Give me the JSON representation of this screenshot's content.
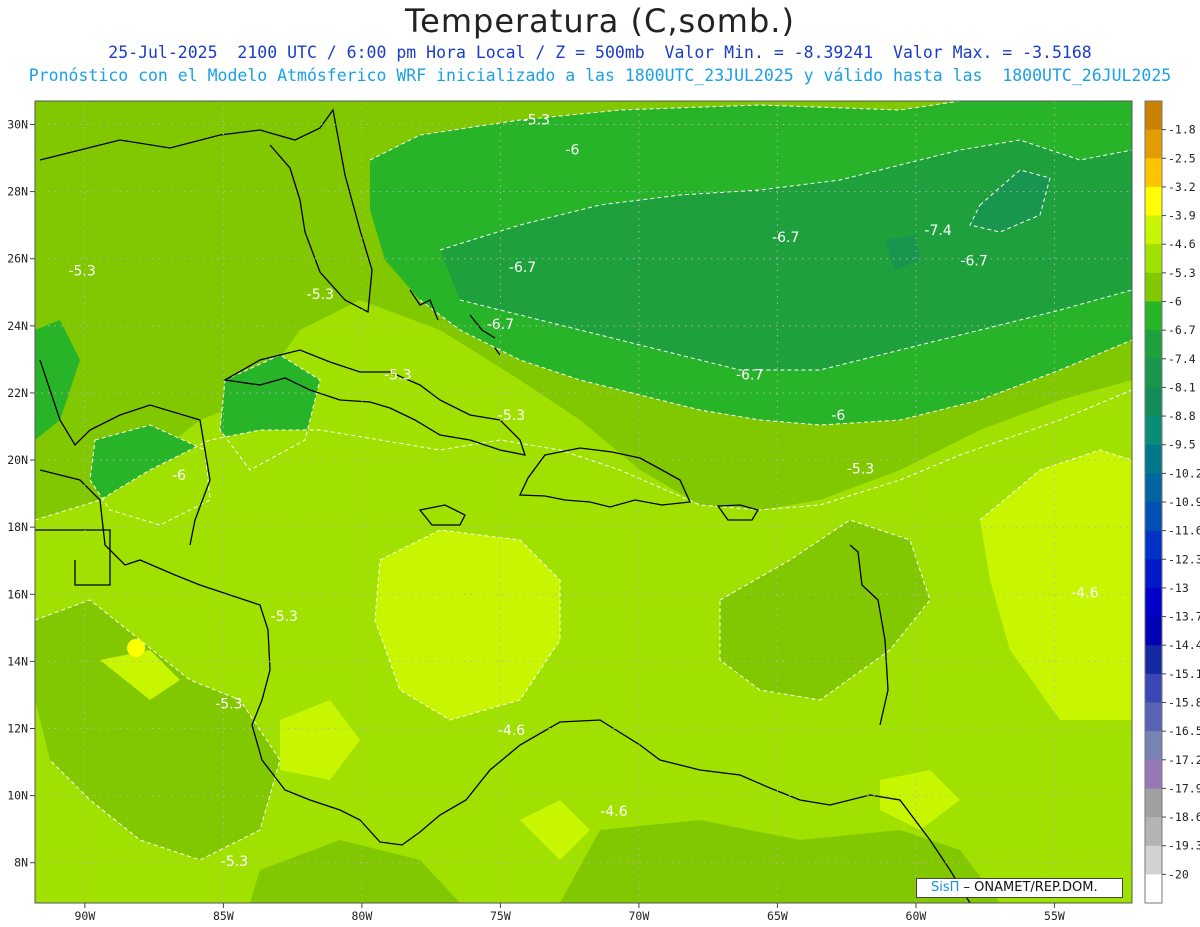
{
  "header": {
    "title": "Temperatura (C,somb.)",
    "line1": "25-Jul-2025  2100 UTC / 6:00 pm Hora Local / Z = 500mb  Valor Min. = -8.39241  Valor Max. = -3.5168",
    "line2": "Pronóstico con el Modelo Atmósferico WRF inicializado a las 1800UTC_23JUL2025 y válido hasta las  1800UTC_26JUL2025"
  },
  "axes": {
    "lat_labels": [
      "30N",
      "28N",
      "26N",
      "24N",
      "22N",
      "20N",
      "18N",
      "16N",
      "14N",
      "12N",
      "10N",
      "8N"
    ],
    "lon_labels": [
      "90W",
      "85W",
      "80W",
      "75W",
      "70W",
      "65W",
      "60W",
      "55W"
    ],
    "lat_range": [
      6.8,
      30.7
    ],
    "lon_range": [
      -91.8,
      -52.2
    ]
  },
  "colorbar": {
    "levels": [
      "-1.8",
      "-2.5",
      "-3.2",
      "-3.9",
      "-4.6",
      "-5.3",
      "-6",
      "-6.7",
      "-7.4",
      "-8.1",
      "-8.8",
      "-9.5",
      "-10.2",
      "-10.9",
      "-11.6",
      "-12.3",
      "-13",
      "-13.7",
      "-14.4",
      "-15.1",
      "-15.8",
      "-16.5",
      "-17.2",
      "-17.9",
      "-18.6",
      "-19.3",
      "-20"
    ],
    "colors": [
      "#c88200",
      "#e49c00",
      "#ffc400",
      "#ffff00",
      "#c8f500",
      "#a0e100",
      "#82c800",
      "#28b428",
      "#1ea03c",
      "#189650",
      "#148c5a",
      "#0a8c78",
      "#00788c",
      "#0064a0",
      "#0050b4",
      "#0032c8",
      "#0019c8",
      "#0000c8",
      "#0000b4",
      "#1428a0",
      "#3c46b4",
      "#5a64b4",
      "#7882b4",
      "#9678b4",
      "#a0a0a0",
      "#b4b4b4",
      "#d2d2d2",
      "#ffffff"
    ]
  },
  "field_colors": {
    "c39": "#c8f500",
    "c46": "#a0e100",
    "c53": "#82c800",
    "c60": "#28b428",
    "c67": "#1ea03c",
    "c74": "#189650"
  },
  "contour_labels": [
    {
      "text": "-5.3",
      "lon": -73.7,
      "lat": 30.0
    },
    {
      "text": "-6",
      "lon": -72.4,
      "lat": 29.1
    },
    {
      "text": "-5.3",
      "lon": -90.1,
      "lat": 25.5
    },
    {
      "text": "-6.7",
      "lon": -74.2,
      "lat": 25.6
    },
    {
      "text": "-6.7",
      "lon": -64.7,
      "lat": 26.5
    },
    {
      "text": "-7.4",
      "lon": -59.2,
      "lat": 26.7
    },
    {
      "text": "-6.7",
      "lon": -57.9,
      "lat": 25.8
    },
    {
      "text": "-5.3",
      "lon": -81.5,
      "lat": 24.8
    },
    {
      "text": "-6.7",
      "lon": -75.0,
      "lat": 23.9
    },
    {
      "text": "-5.3",
      "lon": -78.7,
      "lat": 22.4
    },
    {
      "text": "-6.7",
      "lon": -66.0,
      "lat": 22.4
    },
    {
      "text": "-5.3",
      "lon": -74.6,
      "lat": 21.2
    },
    {
      "text": "-6",
      "lon": -62.8,
      "lat": 21.2
    },
    {
      "text": "-6",
      "lon": -86.6,
      "lat": 19.4
    },
    {
      "text": "-5.3",
      "lon": -62.0,
      "lat": 19.6
    },
    {
      "text": "-4.6",
      "lon": -53.9,
      "lat": 15.9
    },
    {
      "text": "-5.3",
      "lon": -82.8,
      "lat": 15.2
    },
    {
      "text": "-5.3",
      "lon": -84.8,
      "lat": 12.6
    },
    {
      "text": "-4.6",
      "lon": -74.6,
      "lat": 11.8
    },
    {
      "text": "-4.6",
      "lon": -70.9,
      "lat": 9.4
    },
    {
      "text": "-5.3",
      "lon": -84.6,
      "lat": 7.9
    }
  ],
  "credit": {
    "brand": "SisΠ",
    "text": " – ONAMET/REP.DOM."
  }
}
